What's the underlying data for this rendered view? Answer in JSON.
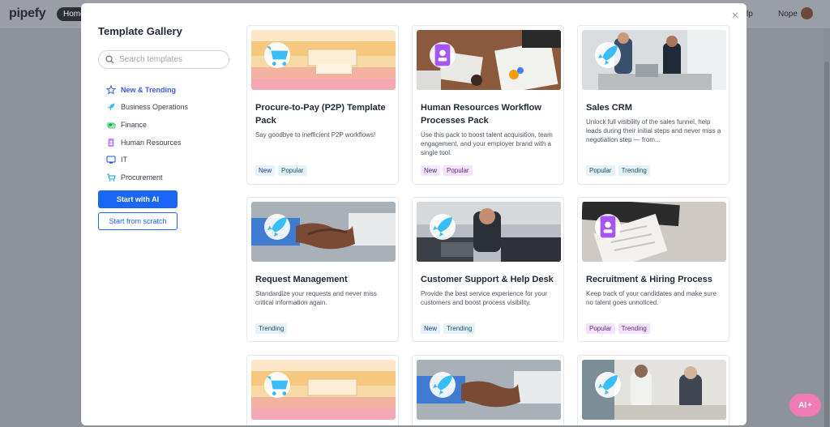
{
  "app": {
    "logo": "pipefy",
    "home_label": "Home",
    "help_label": "Help",
    "user_name": "Nope"
  },
  "gallery": {
    "title": "Template Gallery",
    "search_placeholder": "Search templates",
    "categories": [
      {
        "label": "New & Trending",
        "icon": "star-icon",
        "active": true
      },
      {
        "label": "Business Operations",
        "icon": "rocket-icon",
        "active": false
      },
      {
        "label": "Finance",
        "icon": "money-icon",
        "active": false
      },
      {
        "label": "Human Resources",
        "icon": "badge-icon",
        "active": false
      },
      {
        "label": "IT",
        "icon": "monitor-icon",
        "active": false
      },
      {
        "label": "Procurement",
        "icon": "cart-icon",
        "active": false
      }
    ],
    "start_ai_label": "Start with AI",
    "start_scratch_label": "Start from scratch"
  },
  "cards": [
    {
      "title": "Procure-to-Pay (P2P) Template Pack",
      "desc": "Say goodbye to inefficient P2P workflows!",
      "tags": [
        "New",
        "Popular"
      ],
      "icon": "cart-icon"
    },
    {
      "title": "Human Resources Workflow Processes Pack",
      "desc": "Use this pack to boost talent acquisition, team engagement, and your employer brand with a single tool.",
      "tags": [
        "New",
        "Popular"
      ],
      "icon": "badge-icon"
    },
    {
      "title": "Sales CRM",
      "desc": "Unlock full visibility of the sales funnel, help leads during their initial steps and never miss a negotiation step — from...",
      "tags": [
        "Popular",
        "Trending"
      ],
      "icon": "rocket-icon"
    },
    {
      "title": "Request Management",
      "desc": "Standardize your requests and never miss critical information again.",
      "tags": [
        "Trending"
      ],
      "icon": "rocket-icon"
    },
    {
      "title": "Customer Support & Help Desk",
      "desc": "Provide the best service experience for your customers and boost process visibility.",
      "tags": [
        "New",
        "Trending"
      ],
      "icon": "rocket-icon"
    },
    {
      "title": "Recruitment & Hiring Process",
      "desc": "Keep track of your candidates and make sure no talent goes unnoticed.",
      "tags": [
        "Popular",
        "Trending"
      ],
      "icon": "badge-icon"
    }
  ],
  "ai_fab_label": "AI",
  "colors": {
    "primary": "#1a66f5",
    "accent_purple": "#a855f7",
    "accent_teal": "#38bdf8"
  }
}
